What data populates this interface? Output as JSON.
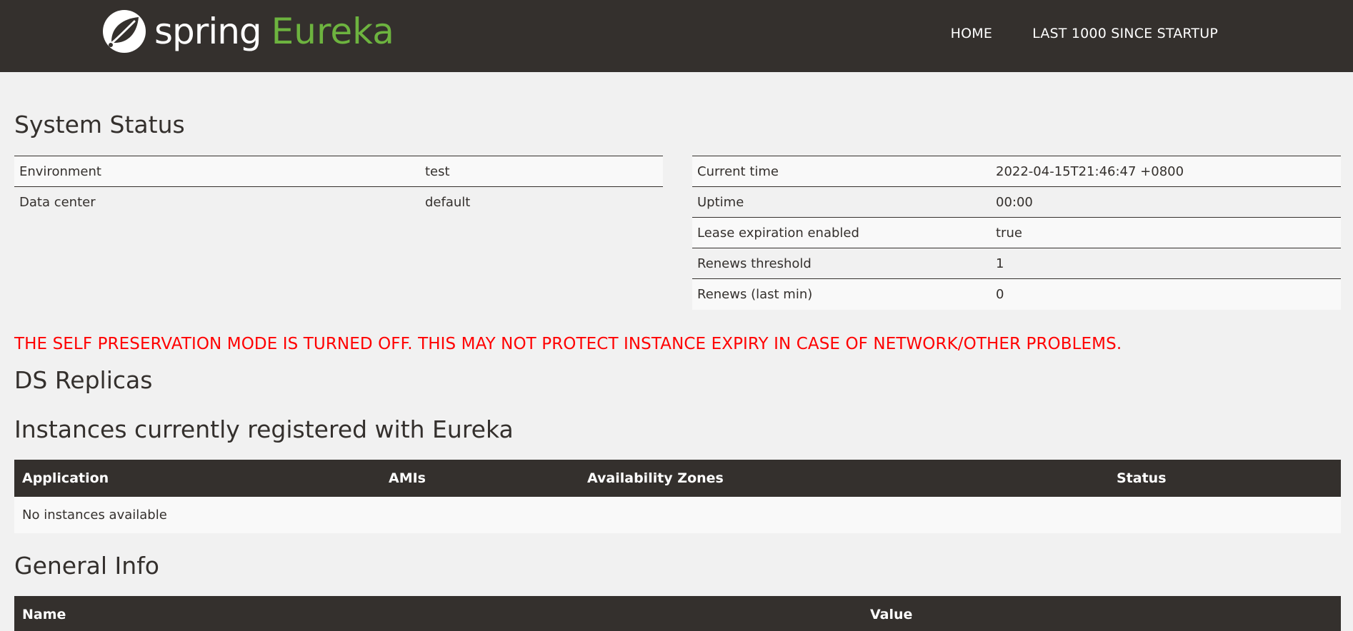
{
  "brand": {
    "spring": "spring",
    "eureka": "Eureka"
  },
  "nav": {
    "home": "HOME",
    "last1000": "LAST 1000 SINCE STARTUP"
  },
  "system_status": {
    "title": "System Status",
    "left": [
      {
        "key": "Environment",
        "value": "test"
      },
      {
        "key": "Data center",
        "value": "default"
      }
    ],
    "right": [
      {
        "key": "Current time",
        "value": "2022-04-15T21:46:47 +0800"
      },
      {
        "key": "Uptime",
        "value": "00:00"
      },
      {
        "key": "Lease expiration enabled",
        "value": "true"
      },
      {
        "key": "Renews threshold",
        "value": "1"
      },
      {
        "key": "Renews (last min)",
        "value": "0"
      }
    ]
  },
  "warning": "THE SELF PRESERVATION MODE IS TURNED OFF. THIS MAY NOT PROTECT INSTANCE EXPIRY IN CASE OF NETWORK/OTHER PROBLEMS.",
  "ds_replicas": {
    "title": "DS Replicas"
  },
  "instances": {
    "title": "Instances currently registered with Eureka",
    "columns": [
      "Application",
      "AMIs",
      "Availability Zones",
      "Status"
    ],
    "empty_message": "No instances available"
  },
  "general_info": {
    "title": "General Info",
    "columns": [
      "Name",
      "Value"
    ]
  },
  "colors": {
    "navbar": "#34302d",
    "brand_green": "#6db33f",
    "warning": "#ff0000",
    "background": "#f1f1f1"
  },
  "icons": {
    "logo": "spring-leaf-icon"
  }
}
